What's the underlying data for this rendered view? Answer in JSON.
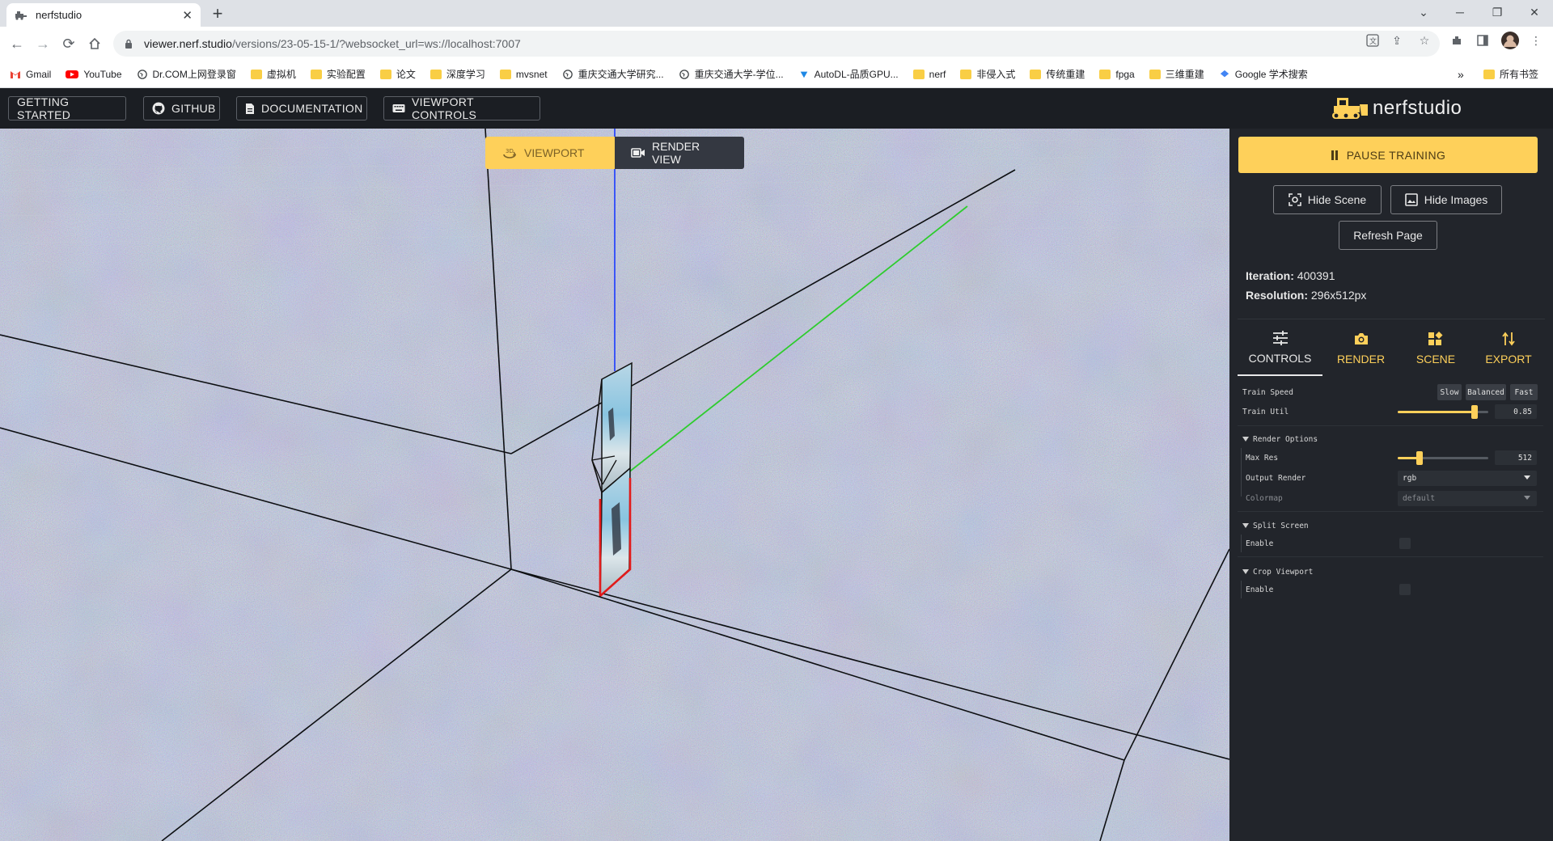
{
  "browser": {
    "tab_title": "nerfstudio",
    "url_host": "viewer.nerf.studio",
    "url_path": "/versions/23-05-15-1/?websocket_url=ws://localhost:7007",
    "bookmarks": [
      {
        "label": "Gmail",
        "icon": "gmail-icon"
      },
      {
        "label": "YouTube",
        "icon": "youtube-icon"
      },
      {
        "label": "Dr.COM上网登录窗",
        "icon": "globe-icon"
      },
      {
        "label": "虚拟机",
        "icon": "folder-icon"
      },
      {
        "label": "实验配置",
        "icon": "folder-icon"
      },
      {
        "label": "论文",
        "icon": "folder-icon"
      },
      {
        "label": "深度学习",
        "icon": "folder-icon"
      },
      {
        "label": "mvsnet",
        "icon": "folder-icon"
      },
      {
        "label": "重庆交通大学研究...",
        "icon": "globe-icon"
      },
      {
        "label": "重庆交通大学-学位...",
        "icon": "globe-icon"
      },
      {
        "label": "AutoDL-品质GPU...",
        "icon": "autodl-icon"
      },
      {
        "label": "nerf",
        "icon": "folder-icon"
      },
      {
        "label": "非侵入式",
        "icon": "folder-icon"
      },
      {
        "label": "传统重建",
        "icon": "folder-icon"
      },
      {
        "label": "fpga",
        "icon": "folder-icon"
      },
      {
        "label": "三维重建",
        "icon": "folder-icon"
      },
      {
        "label": "Google 学术搜索",
        "icon": "scholar-icon"
      }
    ],
    "overflow_label": "»",
    "all_bookmarks": "所有书签"
  },
  "header": {
    "getting_started": "GETTING STARTED",
    "github": "GITHUB",
    "documentation": "DOCUMENTATION",
    "viewport_controls": "VIEWPORT CONTROLS",
    "logo_text": "nerfstudio"
  },
  "viewport": {
    "tab_viewport": "VIEWPORT",
    "tab_render": "RENDER VIEW"
  },
  "panel": {
    "pause": "PAUSE TRAINING",
    "hide_scene": "Hide Scene",
    "hide_images": "Hide Images",
    "refresh": "Refresh Page",
    "iteration_label": "Iteration:",
    "iteration_value": "400391",
    "resolution_label": "Resolution:",
    "resolution_value": "296x512px",
    "tabs": {
      "controls": "CONTROLS",
      "render": "RENDER",
      "scene": "SCENE",
      "export": "EXPORT"
    },
    "controls": {
      "train_speed": "Train Speed",
      "speed_slow": "Slow",
      "speed_balanced": "Balanced",
      "speed_fast": "Fast",
      "train_util": "Train Util",
      "train_util_value": "0.85",
      "train_util_fraction": 0.85,
      "render_options": "Render Options",
      "max_res": "Max Res",
      "max_res_value": "512",
      "max_res_fraction": 0.24,
      "output_render": "Output Render",
      "output_render_value": "rgb",
      "colormap": "Colormap",
      "colormap_value": "default",
      "split_screen": "Split Screen",
      "split_enable": "Enable",
      "crop_viewport": "Crop Viewport",
      "crop_enable": "Enable"
    }
  },
  "colors": {
    "accent": "#fed05a",
    "panel_bg": "#22252b",
    "header_bg": "#1b1e23"
  }
}
